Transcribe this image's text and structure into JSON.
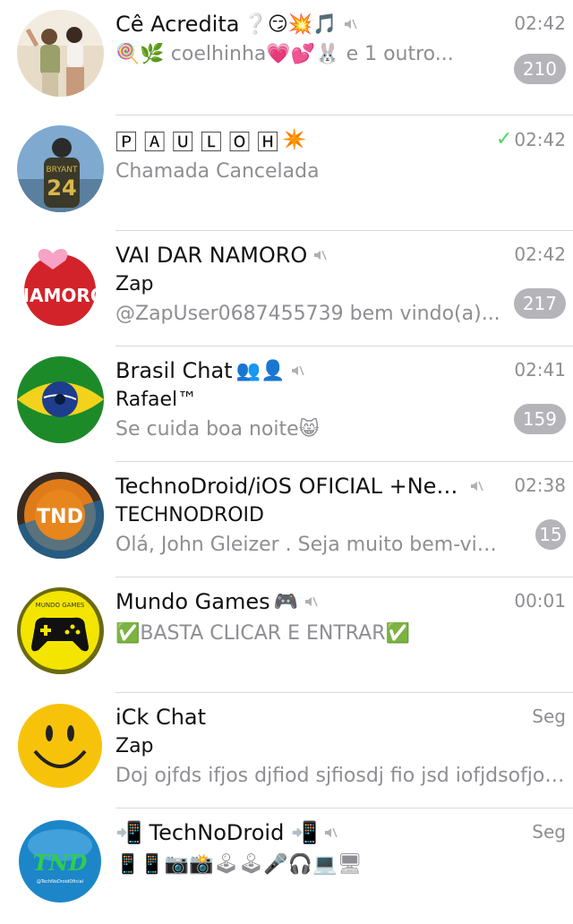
{
  "chats": [
    {
      "name": "Cê Acredita",
      "name_emoji": "❔😏💥🎵",
      "muted": true,
      "time": "02:42",
      "sender": "",
      "message": "🍭🌿 coelhinha💗💕🐰 e 1 outro...",
      "message2": "",
      "unread": "210",
      "avatar_icon": "couple-photo-avatar"
    },
    {
      "name": "🄿 🄰 🅄 🄻 🄾 🄷",
      "name_emoji": "✴️",
      "muted": false,
      "read_check": "✓",
      "time": "02:42",
      "sender": "",
      "message": "Chamada Cancelada",
      "message2": "",
      "unread": "",
      "avatar_icon": "bryant-24-jersey-avatar"
    },
    {
      "name": "VAI DAR NAMORO",
      "name_emoji": "",
      "muted": true,
      "time": "02:42",
      "sender": "Zap",
      "message": "@ZapUser0687455739 bem vindo(a)...",
      "message2": "",
      "unread": "217",
      "avatar_icon": "namoro-heart-avatar",
      "avatar_text": "NAMORO"
    },
    {
      "name": "Brasil Chat",
      "name_emoji": "👥👤",
      "muted": true,
      "time": "02:41",
      "sender": "Rafael™",
      "message": "Se cuida boa noite😸",
      "message2": "",
      "unread": "159",
      "avatar_icon": "brazil-flag-eye-avatar"
    },
    {
      "name": "TechnoDroid/iOS OFICIAL +Net...",
      "name_emoji": "",
      "muted": true,
      "time": "02:38",
      "sender": "TECHNODROID",
      "message": "Olá, John Gleizer . Seja muito bem-vind...",
      "message2": "",
      "unread": "15",
      "avatar_icon": "tnd-logo-avatar",
      "avatar_text": "TND"
    },
    {
      "name": "Mundo Games",
      "name_emoji": "🎮",
      "muted": true,
      "time": "00:01",
      "sender": "",
      "message": "✅BASTA CLICAR E ENTRAR✅",
      "message2": "",
      "unread": "",
      "avatar_icon": "gamepad-avatar",
      "avatar_text": "MUNDO GAMES"
    },
    {
      "name": "iCk Chat",
      "name_emoji": "",
      "muted": false,
      "time": "Seg",
      "sender": "Zap",
      "message": "Doj ojfds ifjos djfiod sjfiosdj fio jsd iofjdsofjo d...",
      "message2": "",
      "unread": "",
      "avatar_icon": "smiley-face-avatar"
    },
    {
      "name": "📲 TechNoDroid 📲",
      "name_emoji": "",
      "muted": true,
      "time": "Seg",
      "sender": "",
      "message": "📱📱📷📸🕹🕹🎤🎧💻🖥",
      "message2": "",
      "unread": "",
      "avatar_icon": "tnd-globe-avatar",
      "avatar_text": "TND",
      "avatar_subtext": "@TechNoDroidOficial"
    }
  ],
  "colors": {
    "time": "#8e8e93",
    "badge": "#b4b4b9",
    "check": "#4cd964",
    "divider": "#d9d9de"
  }
}
